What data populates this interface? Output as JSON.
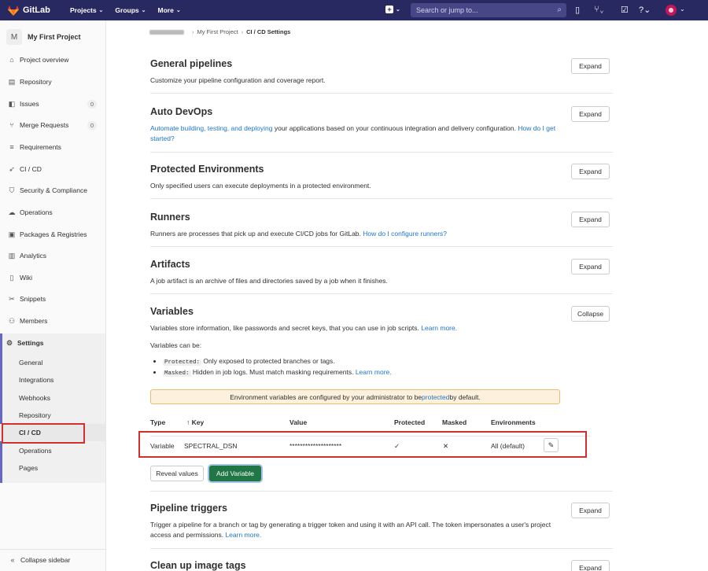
{
  "topbar": {
    "brand": "GitLab",
    "menus": [
      "Projects",
      "Groups",
      "More"
    ],
    "search_placeholder": "Search or jump to..."
  },
  "sidebar": {
    "project_initial": "M",
    "project_name": "My First Project",
    "items": [
      {
        "label": "Project overview",
        "icon": "home-icon"
      },
      {
        "label": "Repository",
        "icon": "book-icon"
      },
      {
        "label": "Issues",
        "icon": "issues-icon",
        "count": "0"
      },
      {
        "label": "Merge Requests",
        "icon": "merge-request-icon",
        "count": "0"
      },
      {
        "label": "Requirements",
        "icon": "requirements-icon"
      },
      {
        "label": "CI / CD",
        "icon": "rocket-icon"
      },
      {
        "label": "Security & Compliance",
        "icon": "shield-icon"
      },
      {
        "label": "Operations",
        "icon": "cloud-gear-icon"
      },
      {
        "label": "Packages & Registries",
        "icon": "package-icon"
      },
      {
        "label": "Analytics",
        "icon": "chart-icon"
      },
      {
        "label": "Wiki",
        "icon": "wiki-icon"
      },
      {
        "label": "Snippets",
        "icon": "scissors-icon"
      },
      {
        "label": "Members",
        "icon": "users-icon"
      }
    ],
    "settings_label": "Settings",
    "settings_sub": [
      "General",
      "Integrations",
      "Webhooks",
      "Repository",
      "CI / CD",
      "Operations",
      "Pages"
    ],
    "collapse_label": "Collapse sidebar"
  },
  "breadcrumb": {
    "project": "My First Project",
    "current": "CI / CD Settings"
  },
  "sections": {
    "general": {
      "title": "General pipelines",
      "desc": "Customize your pipeline configuration and coverage report.",
      "button": "Expand"
    },
    "autodevops": {
      "title": "Auto DevOps",
      "link1": "Automate building, testing, and deploying",
      "desc": " your applications based on your continuous integration and delivery configuration. ",
      "link2": "How do I get started?",
      "button": "Expand"
    },
    "protected": {
      "title": "Protected Environments",
      "desc": "Only specified users can execute deployments in a protected environment.",
      "button": "Expand"
    },
    "runners": {
      "title": "Runners",
      "desc": "Runners are processes that pick up and execute CI/CD jobs for GitLab. ",
      "link": "How do I configure runners?",
      "button": "Expand"
    },
    "artifacts": {
      "title": "Artifacts",
      "desc": "A job artifact is an archive of files and directories saved by a job when it finishes.",
      "button": "Expand"
    },
    "variables": {
      "title": "Variables",
      "desc": "Variables store information, like passwords and secret keys, that you can use in job scripts. ",
      "link": "Learn more.",
      "can_be": "Variables can be:",
      "bullet1_code": "Protected:",
      "bullet1_text": " Only exposed to protected branches or tags.",
      "bullet2_code": "Masked:",
      "bullet2_text": " Hidden in job logs. Must match masking requirements. ",
      "bullet2_link": "Learn more.",
      "button": "Collapse",
      "alert_pre": "Environment variables are configured by your administrator to be ",
      "alert_link": "protected",
      "alert_post": " by default.",
      "table_headers": {
        "type": "Type",
        "key": "↑ Key",
        "value": "Value",
        "protected": "Protected",
        "masked": "Masked",
        "environments": "Environments"
      },
      "row": {
        "type": "Variable",
        "key": "SPECTRAL_DSN",
        "value": "********************",
        "protected": "✓",
        "masked": "✕",
        "environments": "All (default)"
      },
      "reveal_button": "Reveal values",
      "add_button": "Add Variable"
    },
    "triggers": {
      "title": "Pipeline triggers",
      "desc": "Trigger a pipeline for a branch or tag by generating a trigger token and using it with an API call. The token impersonates a user's project access and permissions. ",
      "link": "Learn more.",
      "button": "Expand"
    },
    "cleanup": {
      "title": "Clean up image tags",
      "button": "Expand"
    }
  },
  "colors": {
    "navbar": "#292961",
    "link": "#1f75cb",
    "primary_button": "#217645",
    "highlight": "#d2302f"
  }
}
